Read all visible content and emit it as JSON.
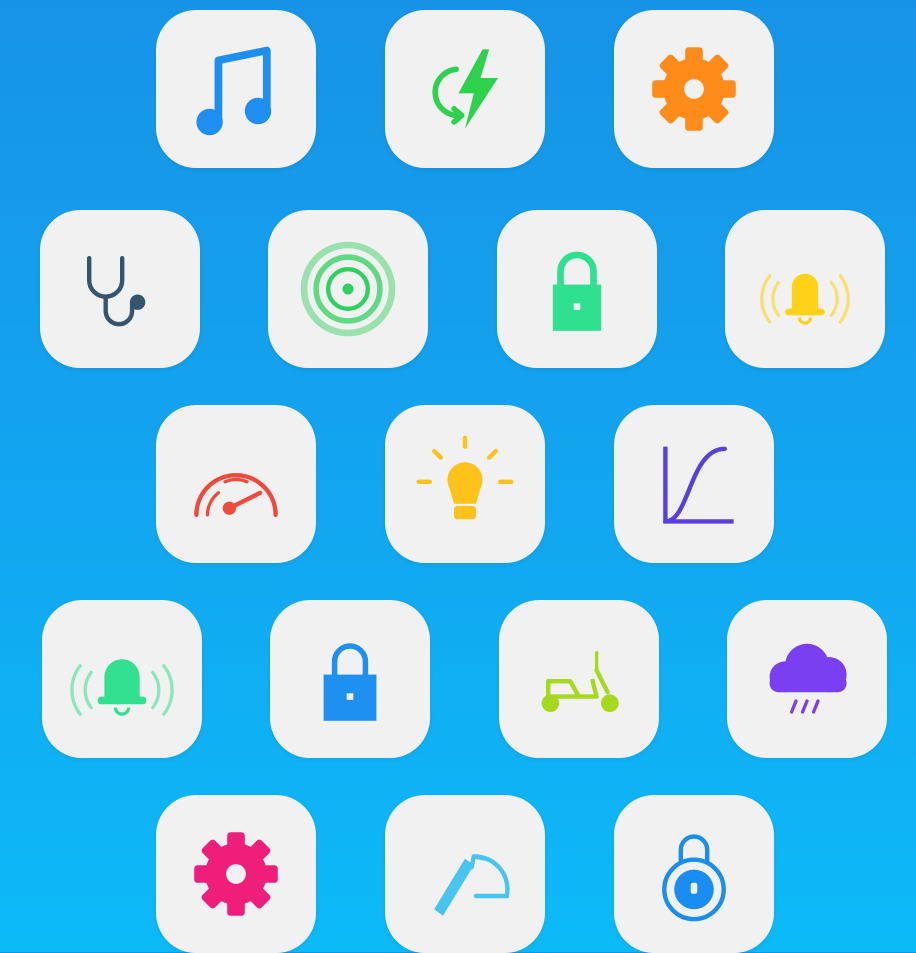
{
  "background": {
    "gradient_top": "#1793e6",
    "gradient_bottom": "#0cbaf8",
    "tile_color": "#f1f1f1"
  },
  "tiles": [
    {
      "icon": "music-note-icon",
      "color": "#1e8ef0"
    },
    {
      "icon": "power-refresh-icon",
      "color": "#2dd14c"
    },
    {
      "icon": "gear-icon",
      "color": "#ff8c1a"
    },
    {
      "icon": "stethoscope-icon",
      "color": "#35546e"
    },
    {
      "icon": "radar-icon",
      "color": "#2ed15e"
    },
    {
      "icon": "lock-icon",
      "color": "#2ee08f"
    },
    {
      "icon": "ringing-bell-icon",
      "color": "#ffd21a"
    },
    {
      "icon": "speedometer-icon",
      "color": "#ef4a3c"
    },
    {
      "icon": "light-bulb-icon",
      "color": "#ffc21a"
    },
    {
      "icon": "growth-curve-icon",
      "color": "#5a3ee0"
    },
    {
      "icon": "ringing-bell-icon",
      "color": "#32e08f"
    },
    {
      "icon": "lock-icon",
      "color": "#1e90f0"
    },
    {
      "icon": "scooter-icon",
      "color": "#a6d81e"
    },
    {
      "icon": "rain-cloud-icon",
      "color": "#7b3ff2"
    },
    {
      "icon": "gear-icon",
      "color": "#ee1e7a"
    },
    {
      "icon": "wiper-icon",
      "color": "#48c4f0"
    },
    {
      "icon": "combination-lock-icon",
      "color": "#1a8ef0"
    }
  ]
}
